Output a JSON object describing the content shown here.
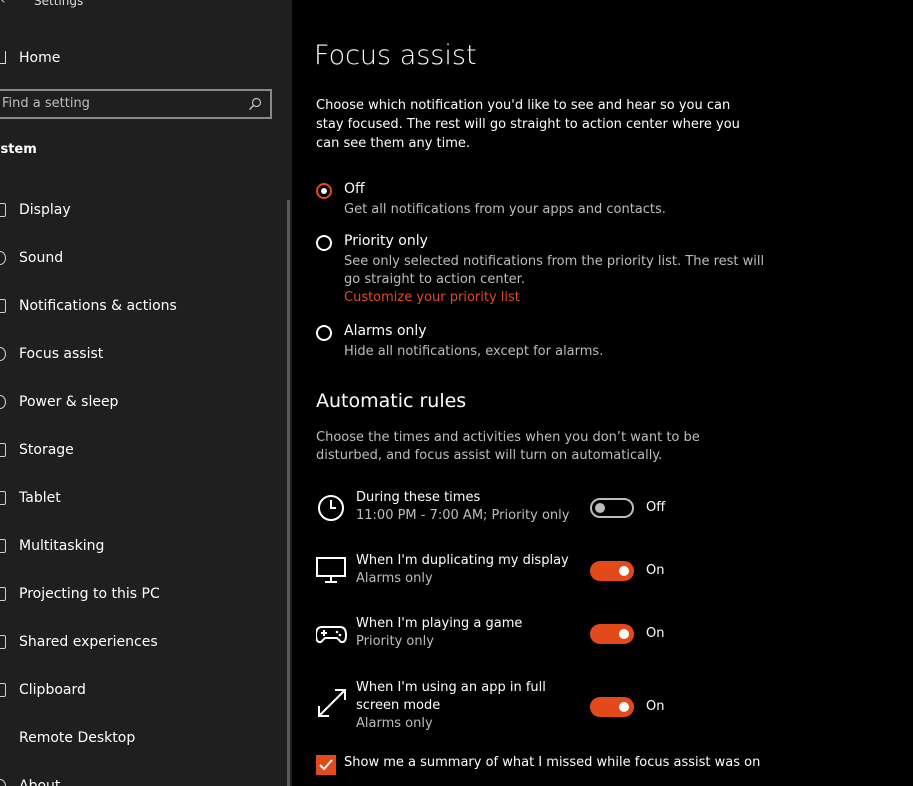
{
  "app": {
    "title": "Settings"
  },
  "sidebar": {
    "home_label": "Home",
    "search_placeholder": "Find a setting",
    "section": "ystem",
    "items": [
      {
        "label": "Display",
        "icon": "display-icon"
      },
      {
        "label": "Sound",
        "icon": "sound-icon"
      },
      {
        "label": "Notifications & actions",
        "icon": "notifications-icon"
      },
      {
        "label": "Focus assist",
        "icon": "focus-assist-icon"
      },
      {
        "label": "Power & sleep",
        "icon": "power-icon"
      },
      {
        "label": "Storage",
        "icon": "storage-icon"
      },
      {
        "label": "Tablet",
        "icon": "tablet-icon"
      },
      {
        "label": "Multitasking",
        "icon": "multitasking-icon"
      },
      {
        "label": "Projecting to this PC",
        "icon": "projecting-icon"
      },
      {
        "label": "Shared experiences",
        "icon": "shared-icon"
      },
      {
        "label": "Clipboard",
        "icon": "clipboard-icon"
      },
      {
        "label": "Remote Desktop",
        "icon": "remote-desktop-icon"
      },
      {
        "label": "About",
        "icon": "about-icon"
      }
    ]
  },
  "main": {
    "title": "Focus assist",
    "intro": "Choose which notification you'd like to see and hear so you can stay focused. The rest will go straight to action center where you can see them any time.",
    "options": [
      {
        "label": "Off",
        "desc": "Get all notifications from your apps and contacts.",
        "checked": true
      },
      {
        "label": "Priority only",
        "desc": "See only selected notifications from the priority list. The rest will go straight to action center.",
        "link": "Customize your priority list",
        "checked": false
      },
      {
        "label": "Alarms only",
        "desc": "Hide all notifications, except for alarms.",
        "checked": false
      }
    ],
    "rules_heading": "Automatic rules",
    "rules_desc": "Choose the times and activities when you don’t want to be disturbed, and focus assist will turn on automatically.",
    "rules": [
      {
        "title": "During these times",
        "sub": "11:00 PM - 7:00 AM; Priority only",
        "state": "Off",
        "icon": "clock-icon"
      },
      {
        "title": "When I'm duplicating my display",
        "sub": "Alarms only",
        "state": "On",
        "icon": "monitor-icon"
      },
      {
        "title": "When I'm playing a game",
        "sub": "Priority only",
        "state": "On",
        "icon": "gamepad-icon"
      },
      {
        "title": "When I'm using an app in full screen mode",
        "sub": "Alarms only",
        "state": "On",
        "icon": "fullscreen-icon"
      }
    ],
    "summary_checkbox": "Show me a summary of what I missed while focus assist was on"
  },
  "colors": {
    "accent": "#e24a1b",
    "sidebar_bg": "#1f1f1f",
    "main_bg": "#000000"
  }
}
